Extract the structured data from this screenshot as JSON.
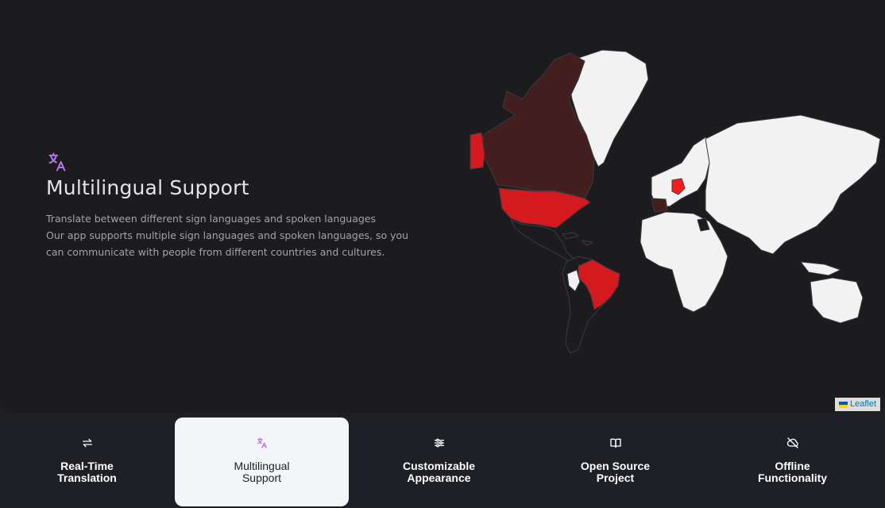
{
  "hero": {
    "icon": "translate-icon",
    "title": "Multilingual Support",
    "subtitle": "Translate between different sign languages and spoken languages",
    "description": "Our app supports multiple sign languages and spoken languages, so you can communicate with people from different countries and cultures."
  },
  "map": {
    "attribution": "Leaflet",
    "colors": {
      "default_land": "#f2f2f3",
      "light_highlight": "#431e1f",
      "strong_highlight": "#d4191f",
      "bright_highlight": "#ff1a1a",
      "border": "#c9c9cc"
    },
    "highlighted_regions": [
      "Canada",
      "Alaska",
      "Iceland",
      "Scandinavia",
      "United States",
      "Brazil",
      "Germany"
    ]
  },
  "tabs": [
    {
      "icon": "arrows-exchange-icon",
      "label": "Real-Time\nTranslation",
      "active": false
    },
    {
      "icon": "translate-icon",
      "label": "Multilingual\nSupport",
      "active": true
    },
    {
      "icon": "sliders-icon",
      "label": "Customizable\nAppearance",
      "active": false
    },
    {
      "icon": "book-open-icon",
      "label": "Open Source\nProject",
      "active": false
    },
    {
      "icon": "cloud-off-icon",
      "label": "Offline\nFunctionality",
      "active": false
    }
  ],
  "accent_color": "#b472e8"
}
